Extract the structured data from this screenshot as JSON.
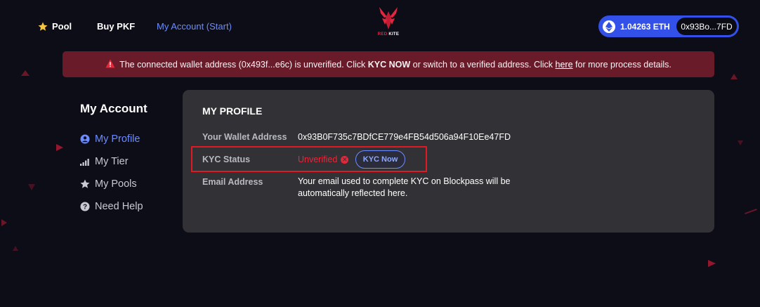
{
  "nav": {
    "pool_label": "Pool",
    "buy_label": "Buy PKF",
    "account_label": "My Account (Start)"
  },
  "logo": {
    "text_red": "RED",
    "text_white": "KITE"
  },
  "wallet": {
    "balance": "1.04263 ETH",
    "address_short": "0x93Bo...7FD"
  },
  "alert": {
    "text_before": "The connected wallet address (0x493f...e6c) is unverified. Click",
    "kyc_now": "KYC NOW",
    "text_middle": "or switch to a verified address. Click",
    "link": "here",
    "text_after": "for more process details."
  },
  "sidebar": {
    "title": "My Account",
    "items": [
      {
        "label": "My Profile",
        "icon": "user-circle-icon"
      },
      {
        "label": "My Tier",
        "icon": "signal-bars-icon"
      },
      {
        "label": "My Pools",
        "icon": "star-icon"
      },
      {
        "label": "Need Help",
        "icon": "question-circle-icon"
      }
    ]
  },
  "profile": {
    "title": "MY PROFILE",
    "wallet_label": "Your Wallet Address",
    "wallet_value": "0x93B0F735c7BDfCE779e4FB54d506a94F10Ee47FD",
    "kyc_label": "KYC Status",
    "kyc_status": "Unverified",
    "kyc_button": "KYC Now",
    "email_label": "Email Address",
    "email_value_line1": "Your email used to complete KYC on Blockpass will be",
    "email_value_line2": "automatically reflected here."
  },
  "colors": {
    "accent": "#6c8cff",
    "wallet_pill": "#3350e8",
    "alert_bg": "#6a1b2a",
    "error": "#e8263a",
    "highlight_box": "#e01a22",
    "card_bg": "#323236",
    "page_bg": "#0d0d18"
  }
}
